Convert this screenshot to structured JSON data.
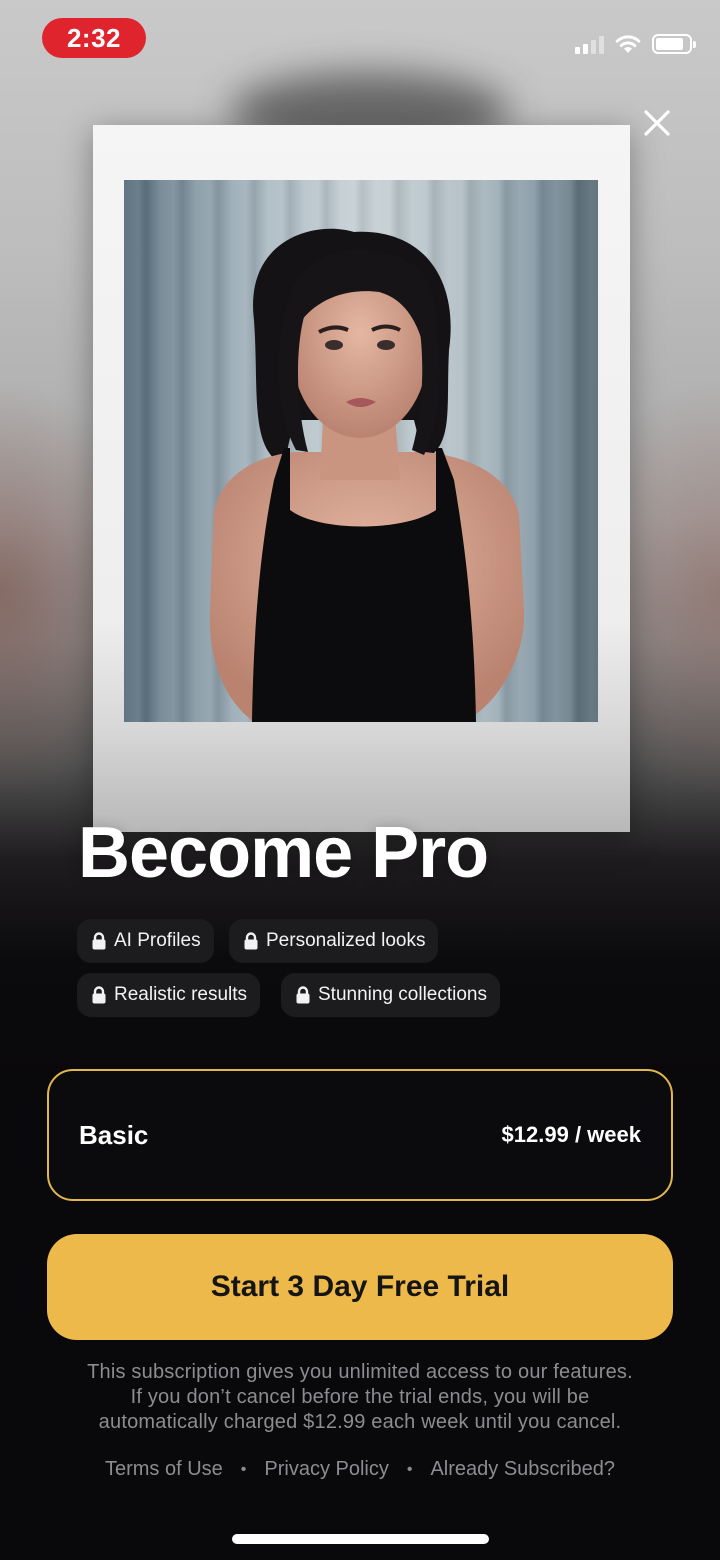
{
  "status_bar": {
    "time": "2:32"
  },
  "paywall": {
    "title": "Become Pro",
    "features": [
      "AI Profiles",
      "Personalized looks",
      "Realistic results",
      "Stunning collections"
    ],
    "plan": {
      "name": "Basic",
      "price": "$12.99 / week"
    },
    "cta_label": "Start 3 Day Free Trial",
    "disclaimer": [
      "This subscription gives you unlimited access to our features.",
      "If you don’t cancel before the trial ends, you will be",
      "automatically charged $12.99 each week until you cancel."
    ],
    "footer_links": [
      "Terms of Use",
      "Privacy Policy",
      "Already Subscribed?"
    ],
    "separator": "•"
  },
  "colors": {
    "accent": "#eeb94b",
    "plan_border": "#e0b64d",
    "background": "#09080a",
    "time_pill": "#e0242e"
  },
  "icons": [
    "close-icon",
    "lock-icon",
    "signal-icon",
    "wifi-icon",
    "battery-icon"
  ]
}
